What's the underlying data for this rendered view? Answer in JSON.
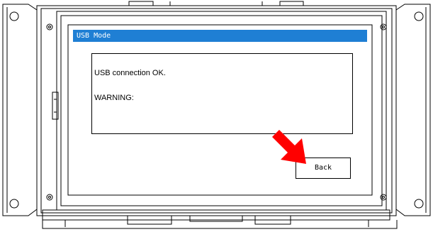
{
  "screen": {
    "title": "USB Mode",
    "title_bar_color": "#1f7fd4",
    "message_lines": [
      "USB connection OK.",
      "WARNING:"
    ],
    "back_button_label": "Back"
  },
  "annotation": {
    "pointer_icon": "red-arrow-icon",
    "pointer_color": "#ff0000"
  }
}
